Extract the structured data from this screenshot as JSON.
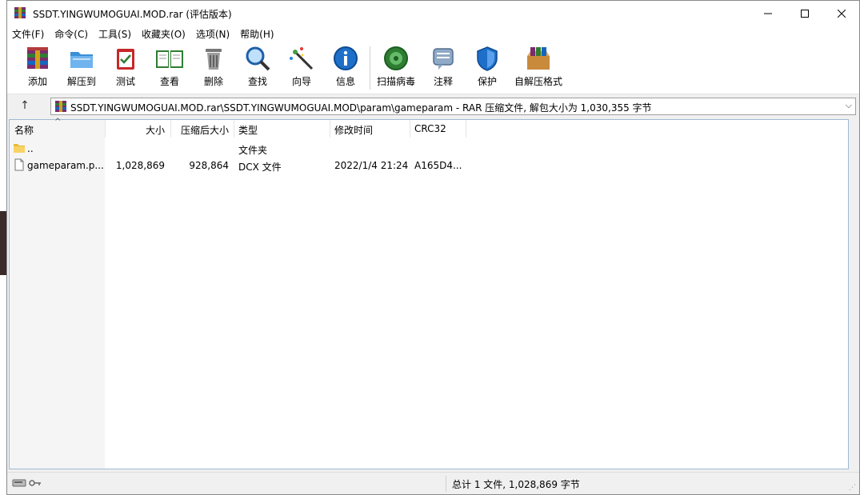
{
  "window": {
    "title": "SSDT.YINGWUMOGUAI.MOD.rar (评估版本)"
  },
  "menu": [
    "文件(F)",
    "命令(C)",
    "工具(S)",
    "收藏夹(O)",
    "选项(N)",
    "帮助(H)"
  ],
  "toolbar": {
    "add": "添加",
    "extract": "解压到",
    "test": "测试",
    "view": "查看",
    "delete": "删除",
    "find": "查找",
    "wizard": "向导",
    "info": "信息",
    "virus_scan": "扫描病毒",
    "comment": "注释",
    "protect": "保护",
    "sfx": "自解压格式"
  },
  "address": {
    "path": "SSDT.YINGWUMOGUAI.MOD.rar\\SSDT.YINGWUMOGUAI.MOD\\param\\gameparam - RAR 压缩文件, 解包大小为 1,030,355 字节"
  },
  "columns": {
    "name": "名称",
    "size": "大小",
    "packed": "压缩后大小",
    "type": "类型",
    "modified": "修改时间",
    "crc": "CRC32"
  },
  "files": [
    {
      "name": "..",
      "size": "",
      "packed": "",
      "type": "文件夹",
      "modified": "",
      "crc": ""
    },
    {
      "name": "gameparam.p...",
      "size": "1,028,869",
      "packed": "928,864",
      "type": "DCX 文件",
      "modified": "2022/1/4 21:24",
      "crc": "A165D4..."
    }
  ],
  "status": {
    "summary": "总计 1 文件, 1,028,869 字节"
  },
  "colors": {
    "accent": "#0a64c8",
    "list_border": "#9fb8d6"
  }
}
